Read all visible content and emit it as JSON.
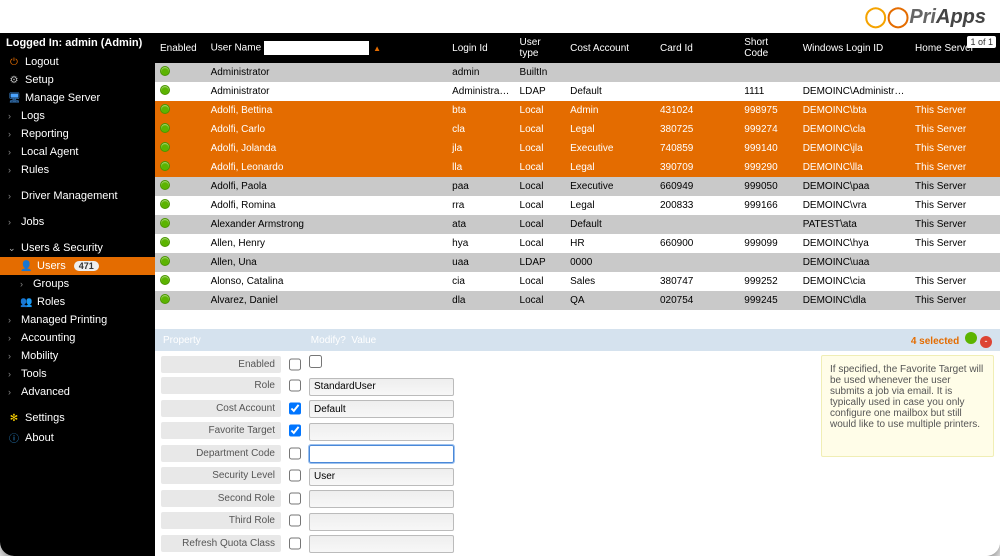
{
  "brand": {
    "full": "PriApps"
  },
  "login_info": "Logged In: admin (Admin)",
  "nav": {
    "logout": "Logout",
    "setup": "Setup",
    "manage_server": "Manage Server",
    "logs": "Logs",
    "reporting": "Reporting",
    "local_agent": "Local Agent",
    "rules": "Rules",
    "driver_mgmt": "Driver Management",
    "jobs": "Jobs",
    "users_security": "Users & Security",
    "users": "Users",
    "users_count": "471",
    "groups": "Groups",
    "roles": "Roles",
    "managed_printing": "Managed Printing",
    "accounting": "Accounting",
    "mobility": "Mobility",
    "tools": "Tools",
    "advanced": "Advanced",
    "settings": "Settings",
    "about": "About"
  },
  "cols": {
    "enabled": "Enabled",
    "user_name": "User Name",
    "login_id": "Login Id",
    "user_type": "User type",
    "cost_account": "Cost Account",
    "card_id": "Card Id",
    "short_code": "Short Code",
    "windows_login_id": "Windows Login ID",
    "home_server": "Home Server"
  },
  "pager": "1 of 1",
  "search_value": "",
  "rows": [
    {
      "sel": false,
      "un": "Administrator",
      "li": "admin",
      "ut": "BuiltIn",
      "ca": "",
      "ci": "",
      "sc": "",
      "wl": "",
      "hs": ""
    },
    {
      "sel": false,
      "un": "Administrator",
      "li": "Administrator",
      "ut": "LDAP",
      "ca": "Default",
      "ci": "",
      "sc": "1111",
      "wl": "DEMOINC\\Administrator",
      "hs": ""
    },
    {
      "sel": true,
      "un": "Adolfi, Bettina",
      "li": "bta",
      "ut": "Local",
      "ca": "Admin",
      "ci": "431024",
      "sc": "998975",
      "wl": "DEMOINC\\bta",
      "hs": "This Server"
    },
    {
      "sel": true,
      "un": "Adolfi, Carlo",
      "li": "cla",
      "ut": "Local",
      "ca": "Legal",
      "ci": "380725",
      "sc": "999274",
      "wl": "DEMOINC\\cla",
      "hs": "This Server"
    },
    {
      "sel": true,
      "un": "Adolfi, Jolanda",
      "li": "jla",
      "ut": "Local",
      "ca": "Executive",
      "ci": "740859",
      "sc": "999140",
      "wl": "DEMOINC\\jla",
      "hs": "This Server"
    },
    {
      "sel": true,
      "un": "Adolfi, Leonardo",
      "li": "lla",
      "ut": "Local",
      "ca": "Legal",
      "ci": "390709",
      "sc": "999290",
      "wl": "DEMOINC\\lla",
      "hs": "This Server"
    },
    {
      "sel": false,
      "un": "Adolfi, Paola",
      "li": "paa",
      "ut": "Local",
      "ca": "Executive",
      "ci": "660949",
      "sc": "999050",
      "wl": "DEMOINC\\paa",
      "hs": "This Server"
    },
    {
      "sel": false,
      "un": "Adolfi, Romina",
      "li": "rra",
      "ut": "Local",
      "ca": "Legal",
      "ci": "200833",
      "sc": "999166",
      "wl": "DEMOINC\\vra",
      "hs": "This Server"
    },
    {
      "sel": false,
      "un": "Alexander Armstrong",
      "li": "ata",
      "ut": "Local",
      "ca": "Default",
      "ci": "",
      "sc": "",
      "wl": "PATEST\\ata",
      "hs": "This Server"
    },
    {
      "sel": false,
      "un": "Allen, Henry",
      "li": "hya",
      "ut": "Local",
      "ca": "HR",
      "ci": "660900",
      "sc": "999099",
      "wl": "DEMOINC\\hya",
      "hs": "This Server"
    },
    {
      "sel": false,
      "un": "Allen, Una",
      "li": "uaa",
      "ut": "LDAP",
      "ca": "0000",
      "ci": "",
      "sc": "",
      "wl": "DEMOINC\\uaa",
      "hs": ""
    },
    {
      "sel": false,
      "un": "Alonso, Catalina",
      "li": "cia",
      "ut": "Local",
      "ca": "Sales",
      "ci": "380747",
      "sc": "999252",
      "wl": "DEMOINC\\cia",
      "hs": "This Server"
    },
    {
      "sel": false,
      "un": "Alvarez, Daniel",
      "li": "dla",
      "ut": "Local",
      "ca": "QA",
      "ci": "020754",
      "sc": "999245",
      "wl": "DEMOINC\\dla",
      "hs": "This Server"
    }
  ],
  "detail": {
    "header": {
      "property": "Property",
      "modify": "Modify?",
      "value": "Value",
      "selected": "4 selected"
    },
    "fields": {
      "enabled": "Enabled",
      "role": "Role",
      "cost_account": "Cost Account",
      "favorite_target": "Favorite Target",
      "department_code": "Department Code",
      "security_level": "Security Level",
      "second_role": "Second Role",
      "third_role": "Third Role",
      "refresh_quota": "Refresh Quota Class"
    },
    "values": {
      "role": "StandardUser",
      "cost_account": "Default",
      "favorite_target": "",
      "department_code": "",
      "security_level": "User",
      "second_role": "",
      "third_role": "",
      "refresh_quota": ""
    },
    "modify": {
      "enabled": false,
      "role": false,
      "cost_account": true,
      "favorite_target": true,
      "department_code": false,
      "security_level": false,
      "second_role": false,
      "third_role": false,
      "refresh_quota": false
    }
  },
  "help": "If specified, the Favorite Target will be used whenever the user submits a job via email. It is typically used in case you only configure one mailbox but still would like to use multiple printers."
}
